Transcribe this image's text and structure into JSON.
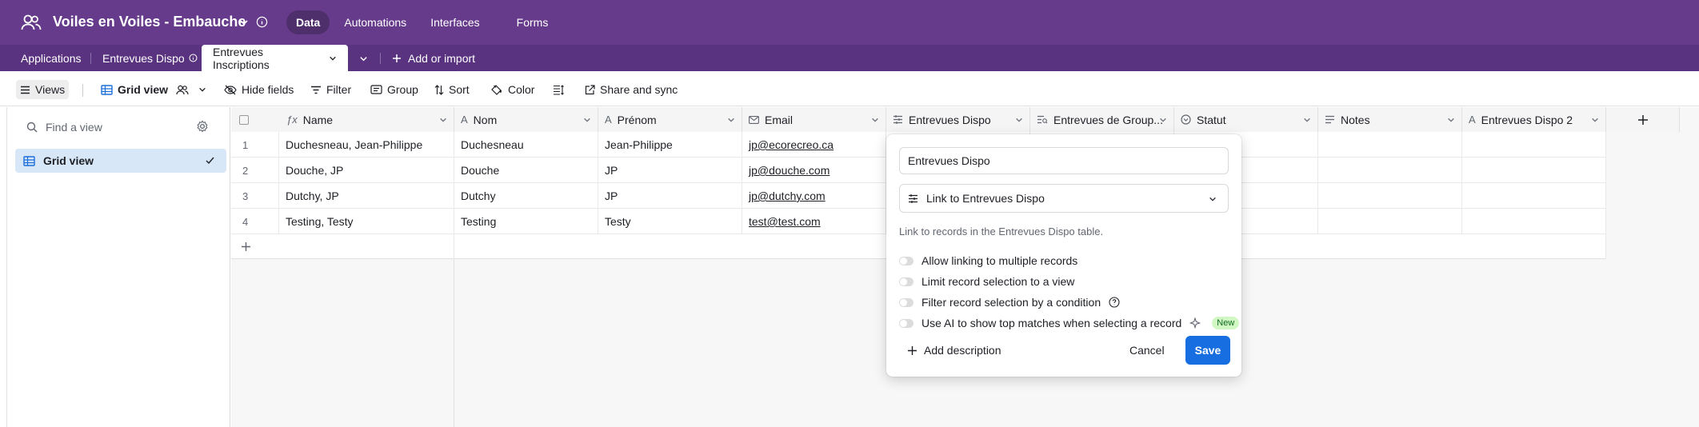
{
  "topbar": {
    "base_title": "Voiles en Voiles - Embauche",
    "nav": [
      "Data",
      "Automations",
      "Interfaces",
      "Forms"
    ]
  },
  "tabs": {
    "items": [
      "Applications",
      "Entrevues Dispo",
      "Entrevues Inscriptions"
    ],
    "add_label": "Add or import"
  },
  "toolbar": {
    "views": "Views",
    "grid_view": "Grid view",
    "hide_fields": "Hide fields",
    "filter": "Filter",
    "group": "Group",
    "sort": "Sort",
    "color": "Color",
    "share": "Share and sync"
  },
  "sidebar": {
    "search_placeholder": "Find a view",
    "view_item": "Grid view"
  },
  "table": {
    "columns": [
      "Name",
      "Nom",
      "Prénom",
      "Email",
      "Entrevues Dispo",
      "Entrevues de Group...",
      "Statut",
      "Notes",
      "Entrevues Dispo 2"
    ],
    "rows": [
      {
        "num": "1",
        "name": "Duchesneau, Jean-Philippe",
        "nom": "Duchesneau",
        "prenom": "Jean-Philippe",
        "email": "jp@ecorecreo.ca"
      },
      {
        "num": "2",
        "name": "Douche, JP",
        "nom": "Douche",
        "prenom": "JP",
        "email": "jp@douche.com"
      },
      {
        "num": "3",
        "name": "Dutchy, JP",
        "nom": "Dutchy",
        "prenom": "JP",
        "email": "jp@dutchy.com"
      },
      {
        "num": "4",
        "name": "Testing, Testy",
        "nom": "Testing",
        "prenom": "Testy",
        "email": "test@test.com"
      }
    ]
  },
  "popover": {
    "field_name": "Entrevues Dispo",
    "field_type": "Link to Entrevues Dispo",
    "description": "Link to records in the Entrevues Dispo table.",
    "options": [
      "Allow linking to multiple records",
      "Limit record selection to a view",
      "Filter record selection by a condition",
      "Use AI to show top matches when selecting a record"
    ],
    "new_badge": "New",
    "add_description": "Add description",
    "cancel": "Cancel",
    "save": "Save"
  }
}
